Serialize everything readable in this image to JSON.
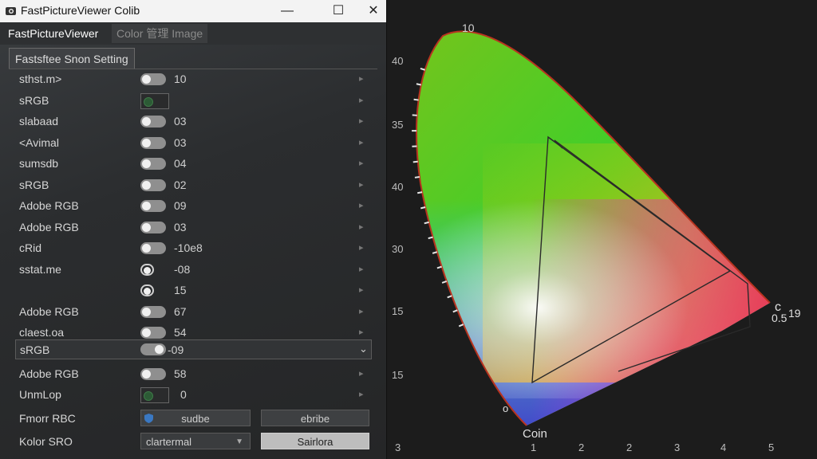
{
  "window": {
    "title": "FastPictureViewer Colib",
    "minimize_glyph": "—",
    "maximize_glyph": "☐",
    "close_glyph": "✕"
  },
  "tabs": [
    {
      "label": "FastPictureViewer"
    },
    {
      "label": "Color 管理 Image"
    }
  ],
  "section_title": "Fastsftee Snon Setting",
  "rows": [
    {
      "label": "sthst.m>",
      "control": "toggle",
      "value": "10"
    },
    {
      "label": "sRGB",
      "control": "colorbox",
      "value": ""
    },
    {
      "label": "slabaad",
      "control": "toggle",
      "value": "03"
    },
    {
      "label": "<Avimal",
      "control": "toggle",
      "value": "03"
    },
    {
      "label": "sumsdb",
      "control": "toggle",
      "value": "04"
    },
    {
      "label": "sRGB",
      "control": "toggle",
      "value": "02"
    },
    {
      "label": "Adobe RGB",
      "control": "toggle",
      "value": "09"
    },
    {
      "label": "Adobe RGB",
      "control": "toggle",
      "value": "03"
    },
    {
      "label": "cRid",
      "control": "toggle",
      "value": "-10e8"
    },
    {
      "label": "sstat.me",
      "control": "ring",
      "value": "-08"
    },
    {
      "label": "",
      "control": "ring",
      "value": "15"
    },
    {
      "label": "Adobe RGB",
      "control": "toggle",
      "value": "67"
    },
    {
      "label": "claest.oa",
      "control": "toggle",
      "value": "54"
    }
  ],
  "srgb_select": {
    "label": "sRGB",
    "value": "-09"
  },
  "rows_after": [
    {
      "label": "Adobe RGB",
      "control": "toggle",
      "value": "58"
    },
    {
      "label": "UnmLop",
      "control": "colorbox",
      "value": "0"
    }
  ],
  "footer": {
    "row1_label": "Fmorr RBC",
    "row1_btn1": "sudbe",
    "row1_btn2": "ebribe",
    "row2_label": "Kolor SRO",
    "row2_dropdown": "clartermal",
    "row2_btn": "Sairlora"
  },
  "chart": {
    "y_ticks": [
      {
        "label": "40"
      },
      {
        "label": "35"
      },
      {
        "label": "40"
      },
      {
        "label": "30"
      },
      {
        "label": "15"
      },
      {
        "label": "15"
      }
    ],
    "x_ticks": [
      "3",
      "1",
      "2",
      "2",
      "3",
      "4",
      "5"
    ],
    "top_label": "10",
    "right_label_1": "c",
    "right_label_2": "0.5",
    "right_label_3": "19",
    "bottom_label": "Coin",
    "point_label": "o",
    "gamut_triangle": {
      "comment_free": true,
      "vertices": [
        [
          0.25,
          0.66
        ],
        [
          0.64,
          0.33
        ],
        [
          0.15,
          0.06
        ]
      ]
    },
    "colors": {
      "background": "#1c1c1c",
      "locus_stroke": "#b8331f",
      "triangle_stroke": "#2a2a2a"
    }
  }
}
